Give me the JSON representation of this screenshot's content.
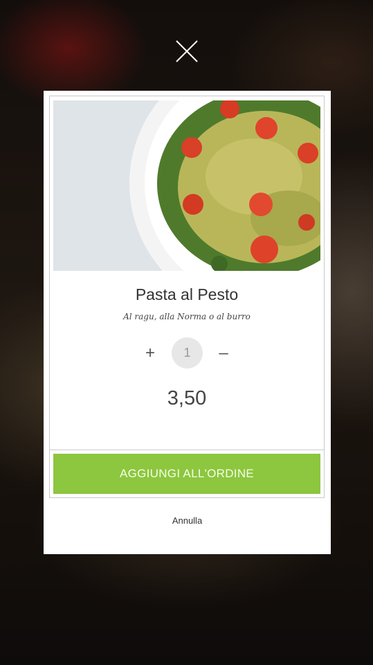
{
  "header": {
    "close_icon": "close-icon"
  },
  "product": {
    "image_icon": "pasta-photo",
    "name": "Pasta al Pesto",
    "description": "Al ragu, alla Norma o al burro",
    "quantity": "1",
    "increment_symbol": "+",
    "decrement_symbol": "–",
    "price": "3,50"
  },
  "actions": {
    "add_label": "AGGIUNGI ALL'ORDINE",
    "cancel_label": "Annulla"
  },
  "colors": {
    "accent_green": "#8dc63f",
    "qty_circle": "#e7e7e7",
    "modal_bg": "#ffffff"
  }
}
